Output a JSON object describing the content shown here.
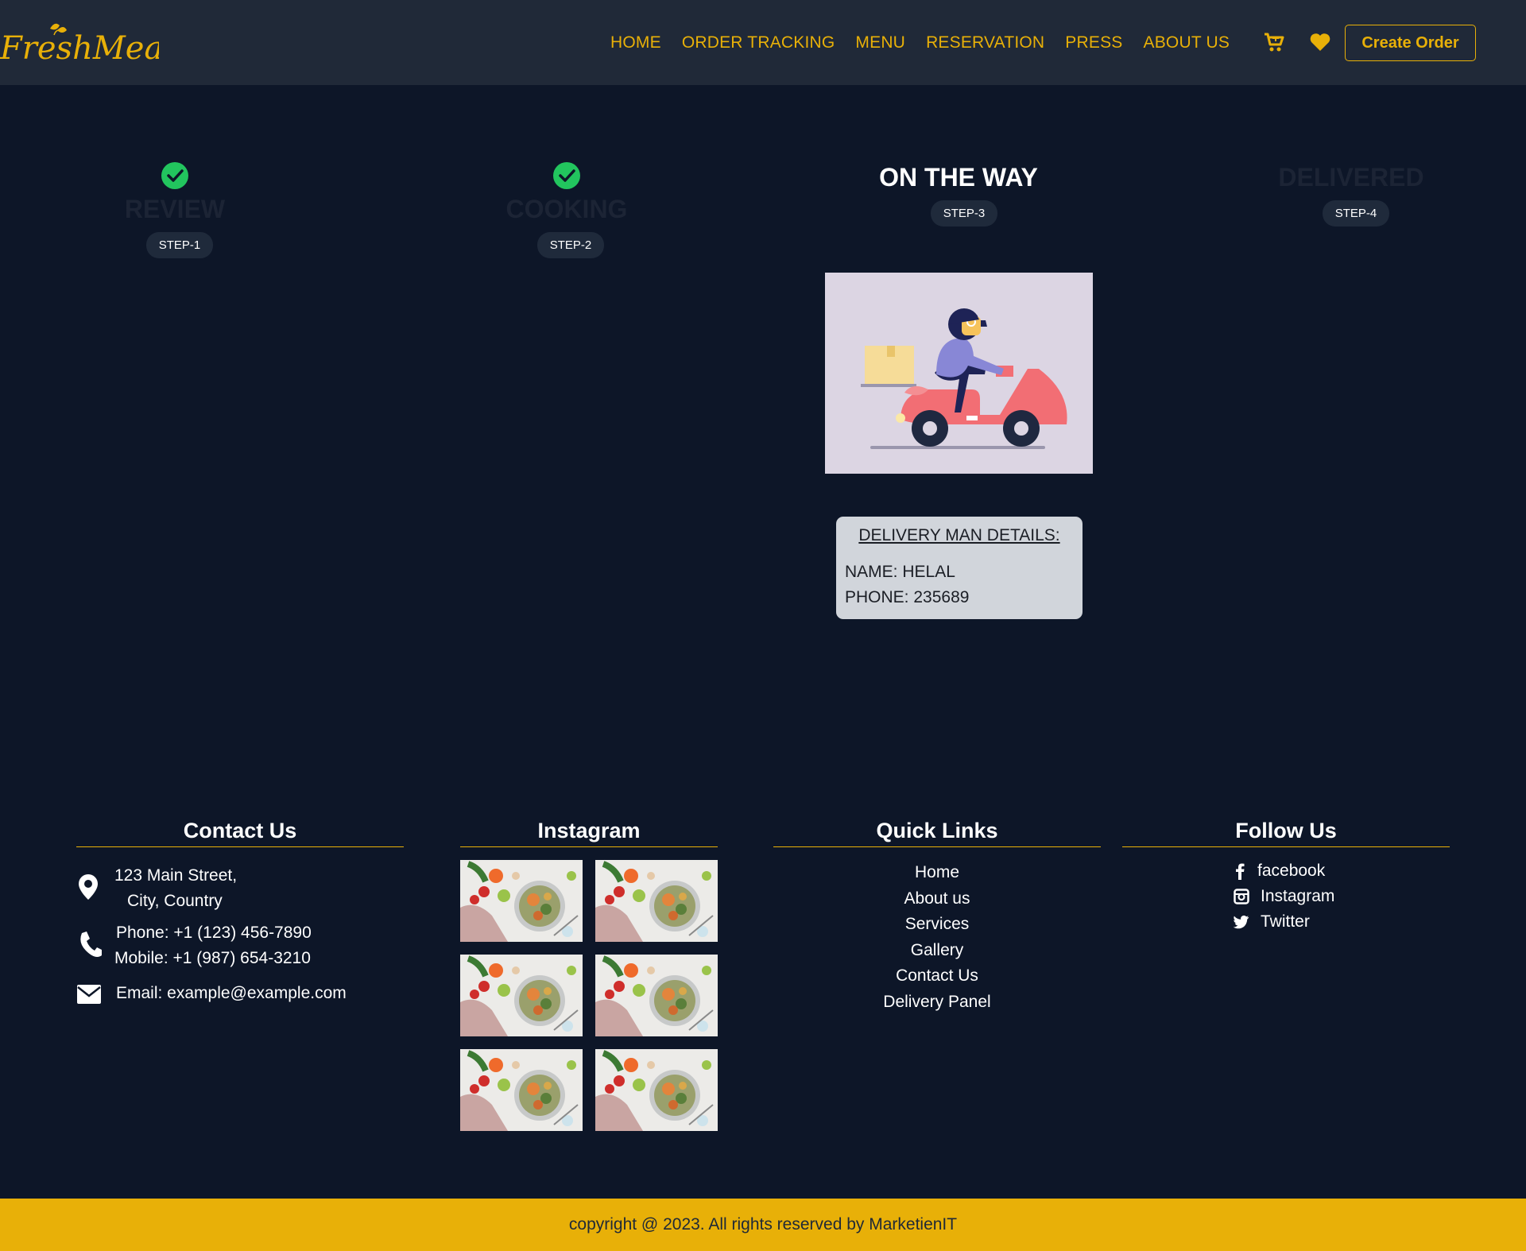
{
  "header": {
    "logo_text": "FreshMeal",
    "nav": [
      "HOME",
      "ORDER TRACKING",
      "MENU",
      "RESERVATION",
      "PRESS",
      "ABOUT US"
    ],
    "cart_icon": "cart-icon",
    "heart_icon": "heart-icon",
    "create_order_label": "Create Order",
    "accent_color": "#e8b008"
  },
  "steps": [
    {
      "title": "REVIEW",
      "label": "STEP-1",
      "status": "done"
    },
    {
      "title": "COOKING",
      "label": "STEP-2",
      "status": "done"
    },
    {
      "title": "ON THE WAY",
      "label": "STEP-3",
      "status": "active"
    },
    {
      "title": "DELIVERED",
      "label": "STEP-4",
      "status": "pending"
    }
  ],
  "delivery": {
    "heading": "DELIVERY MAN DETAILS:",
    "name": "NAME: HELAL",
    "phone": "PHONE: 235689"
  },
  "footer": {
    "contact": {
      "heading": "Contact Us",
      "address_line1": "123 Main Street,",
      "address_line2": "City, Country",
      "phone": "Phone: +1 (123) 456-7890",
      "mobile": "Mobile: +1 (987) 654-3210",
      "email": "Email: example@example.com"
    },
    "instagram": {
      "heading": "Instagram"
    },
    "quick_links": {
      "heading": "Quick Links",
      "items": [
        "Home",
        "About us",
        "Services",
        "Gallery",
        "Contact Us",
        "Delivery Panel"
      ]
    },
    "follow": {
      "heading": "Follow Us",
      "items": [
        "facebook",
        "Instagram",
        "Twitter"
      ]
    }
  },
  "copyright": "copyright @ 2023. All rights reserved by MarketienIT"
}
